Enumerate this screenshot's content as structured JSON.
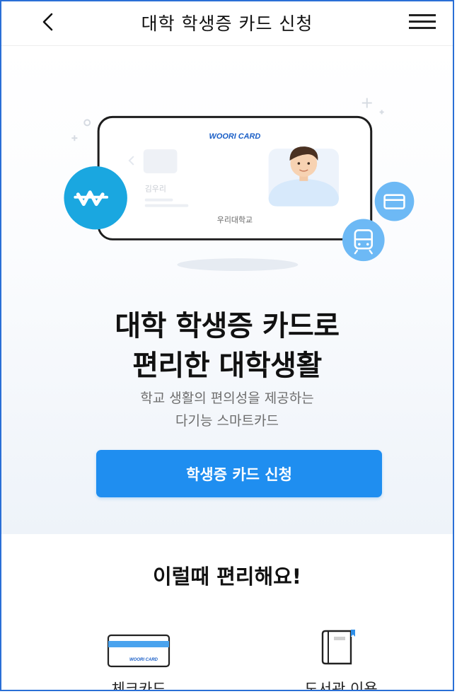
{
  "header": {
    "back_icon": "chevron-left-icon",
    "title": "대학 학생증 카드 신청",
    "menu_icon": "hamburger-menu-icon"
  },
  "hero": {
    "card": {
      "brand": "WOORI CARD",
      "name": "김우리",
      "school": "우리대학교"
    },
    "badges": [
      "won-icon",
      "card-icon",
      "train-icon"
    ],
    "headline_line1": "대학 학생증 카드로",
    "headline_line2": "편리한 대학생활",
    "subtext_line1": "학교 생활의 편의성을 제공하는",
    "subtext_line2": "다기능 스마트카드",
    "apply_button": "학생증 카드 신청"
  },
  "benefits": {
    "title": "이럴때 편리해요!",
    "items": [
      {
        "label": "체크카드",
        "icon": "check-card-icon",
        "icon_text": "WOORI CARD"
      },
      {
        "label": "도서관 이용",
        "icon": "book-icon"
      }
    ]
  },
  "colors": {
    "primary": "#1f8ef0",
    "won_badge": "#1aa7e0",
    "small_badges": "#6db9f5",
    "frame_border": "#2a6fd6"
  }
}
